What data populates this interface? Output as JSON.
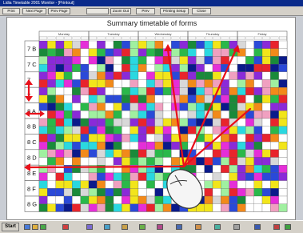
{
  "window": {
    "title": "Lidia Timetable 2001 Monitor - [Printout]"
  },
  "toolbar": {
    "buttons": [
      "Print",
      "Next Page",
      "Prev Page",
      "",
      "Zoom Out",
      "Prev",
      "Printing Setup",
      "Close"
    ]
  },
  "sheet": {
    "title": "Summary timetable of forms",
    "days": [
      "Monday",
      "Tuesday",
      "Wednesday",
      "Thursday",
      "Friday"
    ],
    "forms": [
      "7 B",
      "7 C",
      "7 ",
      "7 ",
      "8 A",
      "8 B",
      "8 C",
      "8 D",
      "8 E",
      "8 F",
      "8 G"
    ]
  },
  "taskbar": {
    "start_label": "Start"
  }
}
